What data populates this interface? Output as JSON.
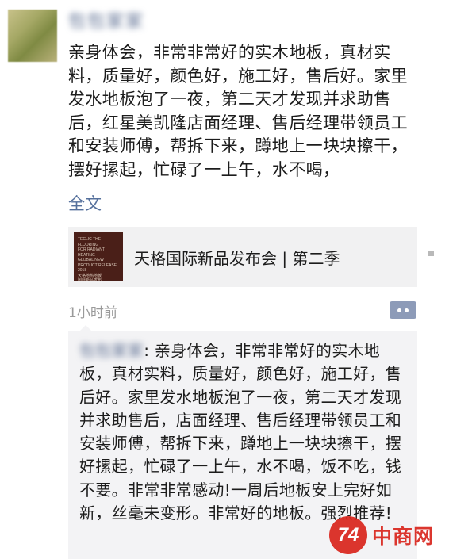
{
  "post": {
    "username": "包包家家",
    "text": "亲身体会，非常非常好的实木地板，真材实料，质量好，颜色好，施工好，售后好。家里发水地板泡了一夜，第二天才发现并求助售后，红星美凯隆店面经理、售后经理带领员工和安装师傅，帮拆下来，蹲地上一块块擦干，摆好摞起，忙碌了一上午，水不喝，",
    "expand_label": "全文"
  },
  "link_card": {
    "thumb_text": "TECLIC THE FLOORING\nFOR RADIANT HEATING\nGLOBAL NEW\nPRODUCT RELEASE\n2018\n天格地热地板\n国际新品发布",
    "title": "天格国际新品发布会 | 第二季"
  },
  "meta": {
    "timestamp": "1小时前"
  },
  "comment": {
    "author": "包包家家",
    "text": ": 亲身体会，非常非常好的实木地板，真材实料，质量好，颜色好，施工好，售后好。家里发水地板泡了一夜，第二天才发现并求助售后，店面经理、售后经理带领员工和安装师傅，帮拆下来，蹲地上一块块擦干，摆好摞起，忙碌了一上午，水不喝，饭不吃，钱不要。非常非常感动!一周后地板安上完好如新，丝毫未变形。非常好的地板。强烈推荐!"
  },
  "watermark": {
    "mark": "74",
    "text": "中商网"
  },
  "colors": {
    "link_blue": "#55709c",
    "card_bg": "#f1f1f2",
    "comment_bg": "#f3f3f5",
    "more_button_bg": "#8d9bb8",
    "watermark_red": "#d9251d"
  }
}
